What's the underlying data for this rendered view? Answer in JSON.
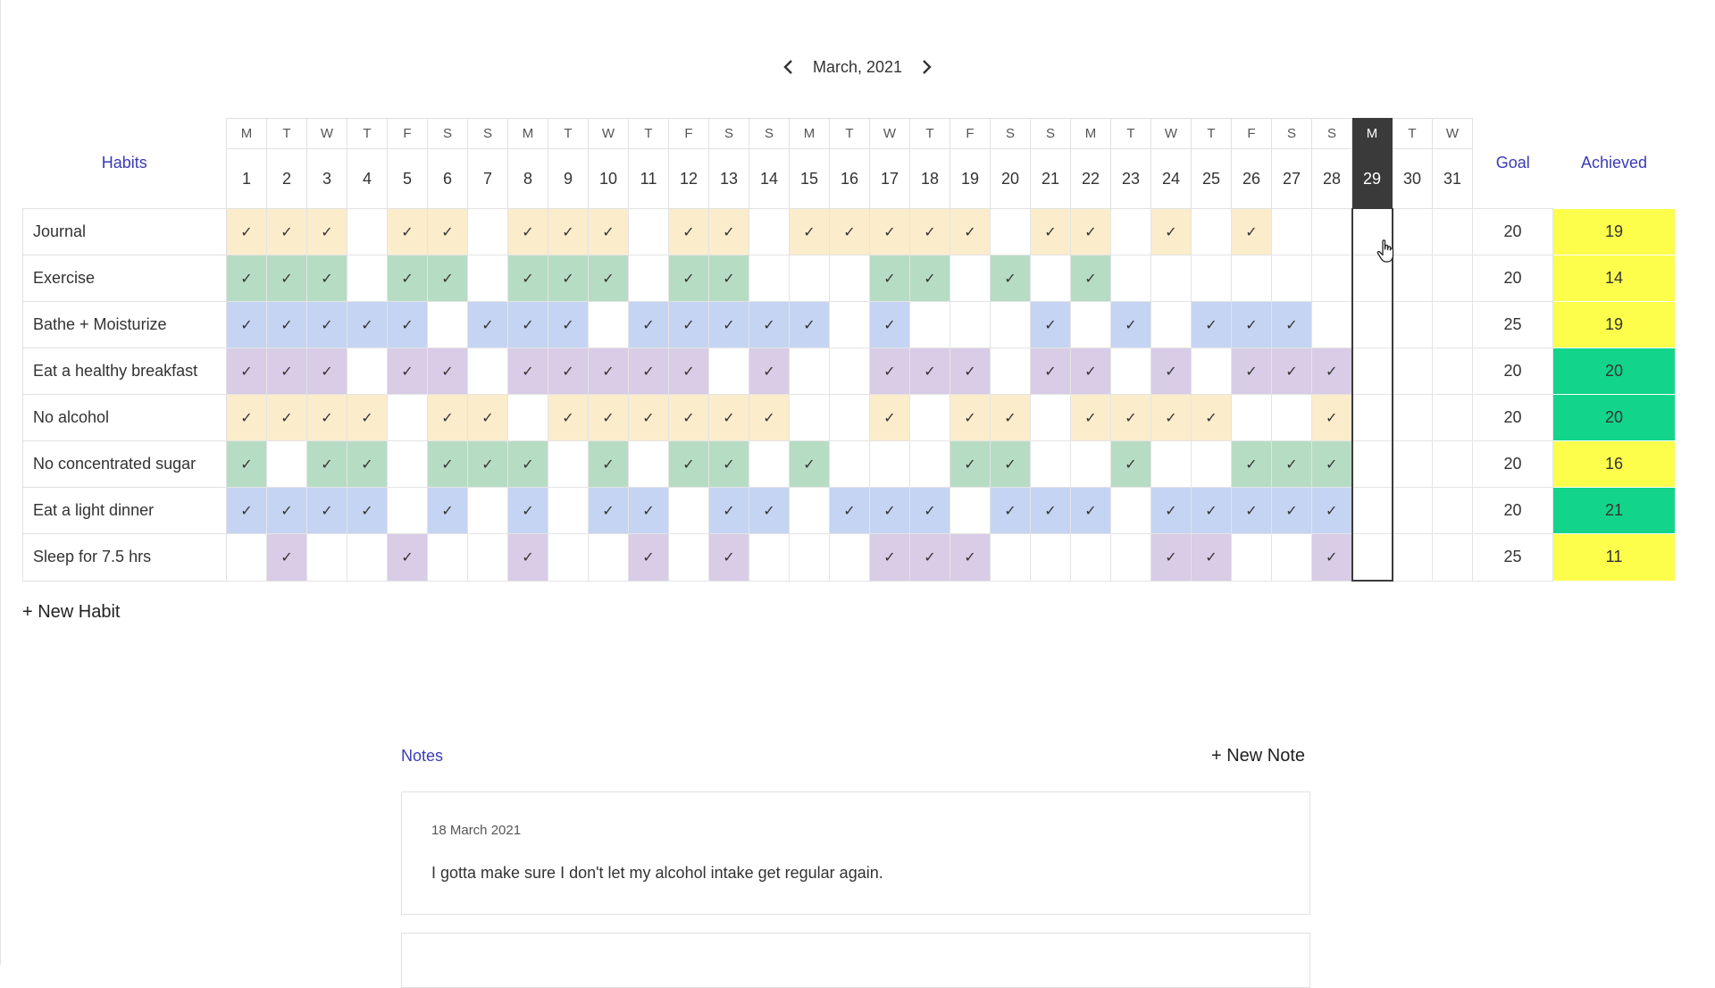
{
  "month_nav": {
    "label": "March, 2021",
    "prev_icon": "chevron-left-icon",
    "next_icon": "chevron-right-icon"
  },
  "headers": {
    "habits": "Habits",
    "goal": "Goal",
    "achieved": "Achieved"
  },
  "weekdays": [
    "M",
    "T",
    "W",
    "T",
    "F",
    "S",
    "S",
    "M",
    "T",
    "W",
    "T",
    "F",
    "S",
    "S",
    "M",
    "T",
    "W",
    "T",
    "F",
    "S",
    "S",
    "M",
    "T",
    "W",
    "T",
    "F",
    "S",
    "S",
    "M",
    "T",
    "W"
  ],
  "days": [
    "1",
    "2",
    "3",
    "4",
    "5",
    "6",
    "7",
    "8",
    "9",
    "10",
    "11",
    "12",
    "13",
    "14",
    "15",
    "16",
    "17",
    "18",
    "19",
    "20",
    "21",
    "22",
    "23",
    "24",
    "25",
    "26",
    "27",
    "28",
    "29",
    "30",
    "31"
  ],
  "today_index": 28,
  "check_mark": "✓",
  "colors": {
    "yellow": "#fbeccb",
    "green": "#b7dcc4",
    "blue": "#c5d4f3",
    "purple": "#d8cce6",
    "achieved_yellow": "#fdfd4c",
    "achieved_green": "#12d58b",
    "link_blue": "#3b3bb5",
    "today_dark": "#3a3a3a"
  },
  "habits": [
    {
      "name": "Journal",
      "color": "yellow",
      "goal": "20",
      "achieved": "19",
      "achieved_status": "yellow",
      "checked": [
        1,
        1,
        1,
        0,
        1,
        1,
        0,
        1,
        1,
        1,
        0,
        1,
        1,
        0,
        1,
        1,
        1,
        1,
        1,
        0,
        1,
        1,
        0,
        1,
        0,
        1,
        0,
        0,
        0,
        0,
        0
      ]
    },
    {
      "name": "Exercise",
      "color": "green",
      "goal": "20",
      "achieved": "14",
      "achieved_status": "yellow",
      "checked": [
        1,
        1,
        1,
        0,
        1,
        1,
        0,
        1,
        1,
        1,
        0,
        1,
        1,
        0,
        0,
        0,
        1,
        1,
        0,
        1,
        0,
        1,
        0,
        0,
        0,
        0,
        0,
        0,
        0,
        0,
        0
      ]
    },
    {
      "name": "Bathe + Moisturize",
      "color": "blue",
      "goal": "25",
      "achieved": "19",
      "achieved_status": "yellow",
      "checked": [
        1,
        1,
        1,
        1,
        1,
        0,
        1,
        1,
        1,
        0,
        1,
        1,
        1,
        1,
        1,
        0,
        1,
        0,
        0,
        0,
        1,
        0,
        1,
        0,
        1,
        1,
        1,
        0,
        0,
        0,
        0
      ]
    },
    {
      "name": "Eat a healthy breakfast",
      "color": "purple",
      "goal": "20",
      "achieved": "20",
      "achieved_status": "green",
      "checked": [
        1,
        1,
        1,
        0,
        1,
        1,
        0,
        1,
        1,
        1,
        1,
        1,
        0,
        1,
        0,
        0,
        1,
        1,
        1,
        0,
        1,
        1,
        0,
        1,
        0,
        1,
        1,
        1,
        0,
        0,
        0
      ]
    },
    {
      "name": "No alcohol",
      "color": "yellow",
      "goal": "20",
      "achieved": "20",
      "achieved_status": "green",
      "checked": [
        1,
        1,
        1,
        1,
        0,
        1,
        1,
        0,
        1,
        1,
        1,
        1,
        1,
        1,
        0,
        0,
        1,
        0,
        1,
        1,
        0,
        1,
        1,
        1,
        1,
        0,
        0,
        1,
        0,
        0,
        0
      ]
    },
    {
      "name": "No concentrated sugar",
      "color": "green",
      "goal": "20",
      "achieved": "16",
      "achieved_status": "yellow",
      "checked": [
        1,
        0,
        1,
        1,
        0,
        1,
        1,
        1,
        0,
        1,
        0,
        1,
        1,
        0,
        1,
        0,
        0,
        0,
        1,
        1,
        0,
        0,
        1,
        0,
        0,
        1,
        1,
        1,
        0,
        0,
        0
      ]
    },
    {
      "name": "Eat a light dinner",
      "color": "blue",
      "goal": "20",
      "achieved": "21",
      "achieved_status": "green",
      "checked": [
        1,
        1,
        1,
        1,
        0,
        1,
        0,
        1,
        0,
        1,
        1,
        0,
        1,
        1,
        0,
        1,
        1,
        1,
        0,
        1,
        1,
        1,
        0,
        1,
        1,
        1,
        1,
        1,
        0,
        0,
        0
      ]
    },
    {
      "name": "Sleep for 7.5 hrs",
      "color": "purple",
      "goal": "25",
      "achieved": "11",
      "achieved_status": "yellow",
      "checked": [
        0,
        1,
        0,
        0,
        1,
        0,
        0,
        1,
        0,
        0,
        1,
        0,
        1,
        0,
        0,
        0,
        1,
        1,
        1,
        0,
        0,
        0,
        0,
        1,
        1,
        0,
        0,
        1,
        0,
        0,
        0
      ]
    }
  ],
  "new_habit_label": "+ New Habit",
  "notes": {
    "title": "Notes",
    "new_note_label": "+ New Note",
    "items": [
      {
        "date": "18 March 2021",
        "text": "I gotta make sure I don't let my alcohol intake get regular again."
      }
    ]
  },
  "cursor_icon": "hand-pointer-icon"
}
